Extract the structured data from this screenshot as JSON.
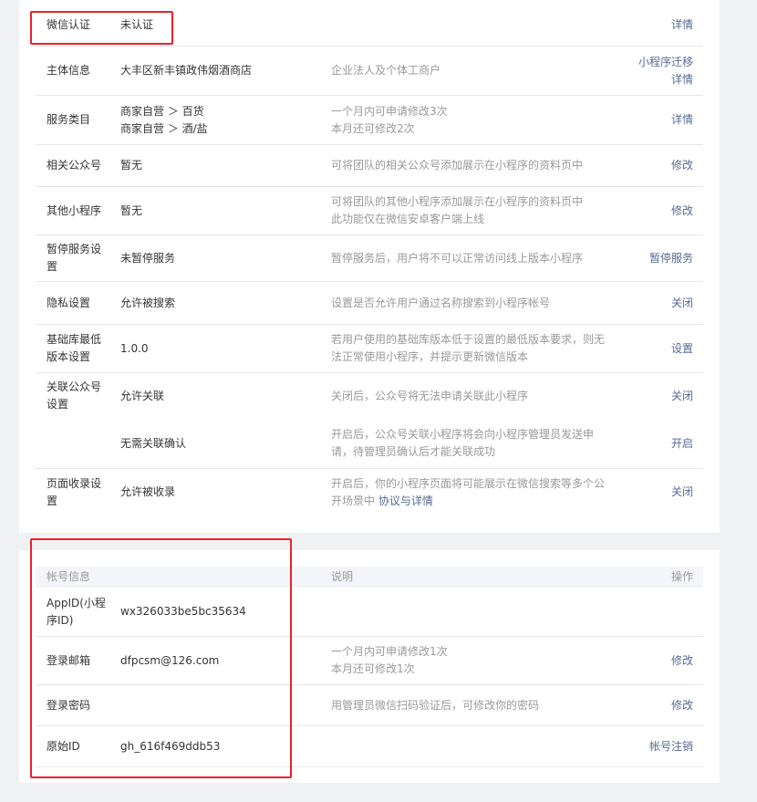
{
  "settings": {
    "wechat_verify": {
      "label": "微信认证",
      "value": "未认证",
      "action": "详情"
    },
    "subject_info": {
      "label": "主体信息",
      "value": "大丰区新丰镇政伟烟酒商店",
      "desc": "企业法人及个体工商户",
      "action1": "小程序迁移",
      "action2": "详情"
    },
    "service_category": {
      "label": "服务类目",
      "value_line1": "商家自营 ＞ 百货",
      "value_line2": "商家自营 ＞ 酒/盐",
      "desc_line1": "一个月内可申请修改3次",
      "desc_line2": "本月还可修改2次",
      "action": "详情"
    },
    "related_official": {
      "label": "相关公众号",
      "value": "暂无",
      "desc": "可将团队的相关公众号添加展示在小程序的资料页中",
      "action": "修改"
    },
    "other_miniprogram": {
      "label": "其他小程序",
      "value": "暂无",
      "desc_line1": "可将团队的其他小程序添加展示在小程序的资料页中",
      "desc_line2": "此功能仅在微信安卓客户端上线",
      "action": "修改"
    },
    "pause_service": {
      "label_line1": "暂停服务设",
      "label_line2": "置",
      "value": "未暂停服务",
      "desc": "暂停服务后，用户将不可以正常访问线上版本小程序",
      "action": "暂停服务"
    },
    "privacy": {
      "label": "隐私设置",
      "value": "允许被搜索",
      "desc": "设置是否允许用户通过名称搜索到小程序帐号",
      "action": "关闭"
    },
    "base_lib": {
      "label_line1": "基础库最低",
      "label_line2": "版本设置",
      "value": "1.0.0",
      "desc_line1": "若用户使用的基础库版本低于设置的最低版本要求，则无",
      "desc_line2": "法正常使用小程序，并提示更新微信版本",
      "action": "设置"
    },
    "link_official": {
      "label_line1": "关联公众号",
      "label_line2": "设置",
      "value": "允许关联",
      "desc": "关闭后，公众号将无法申请关联此小程序",
      "action": "关闭"
    },
    "link_confirm": {
      "value": "无需关联确认",
      "desc_line1": "开启后，公众号关联小程序将会向小程序管理员发送申",
      "desc_line2": "请，待管理员确认后才能关联成功",
      "action": "开启"
    },
    "page_index": {
      "label_line1": "页面收录设",
      "label_line2": "置",
      "value": "允许被收录",
      "desc_line1": "开启后，你的小程序页面将可能展示在微信搜索等多个公",
      "desc_line2_text": "开场景中 ",
      "desc_line2_link": "协议与详情",
      "action": "关闭"
    }
  },
  "account": {
    "header": {
      "col1": "帐号信息",
      "col2": "说明",
      "col3": "操作"
    },
    "appid": {
      "label_line1": "AppID(小程",
      "label_line2": "序ID)",
      "value": "wx326033be5bc35634"
    },
    "email": {
      "label": "登录邮箱",
      "value": "dfpcsm@126.com",
      "desc_line1": "一个月内可申请修改1次",
      "desc_line2": "本月还可修改1次",
      "action": "修改"
    },
    "password": {
      "label": "登录密码",
      "desc": "用管理员微信扫码验证后，可修改你的密码",
      "action": "修改"
    },
    "original_id": {
      "label": "原始ID",
      "value": "gh_616f469ddb53",
      "action": "帐号注销"
    }
  },
  "colors": {
    "link": "#576b95",
    "highlight": "#e8232a",
    "muted": "#9a9a9a",
    "text": "#353535"
  }
}
